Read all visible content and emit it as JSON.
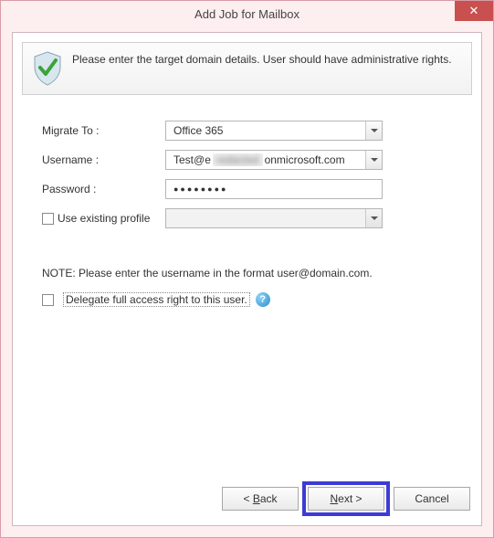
{
  "window": {
    "title": "Add Job for Mailbox"
  },
  "info": {
    "text": "Please enter the target domain details. User should have administrative rights."
  },
  "form": {
    "migrate_label": "Migrate To :",
    "migrate_value": "Office 365",
    "username_label": "Username :",
    "username_prefix": "Test@e",
    "username_hidden": "redacted",
    "username_suffix": "onmicrosoft.com",
    "password_label": "Password :",
    "password_mask": "●●●●●●●●",
    "use_existing_label": "Use existing profile",
    "profile_value": ""
  },
  "note": "NOTE: Please enter the username in the format user@domain.com.",
  "delegate": {
    "label": "Delegate full access right to this user."
  },
  "buttons": {
    "back": "< Back",
    "next": "Next >",
    "cancel": "Cancel"
  },
  "help_glyph": "?"
}
